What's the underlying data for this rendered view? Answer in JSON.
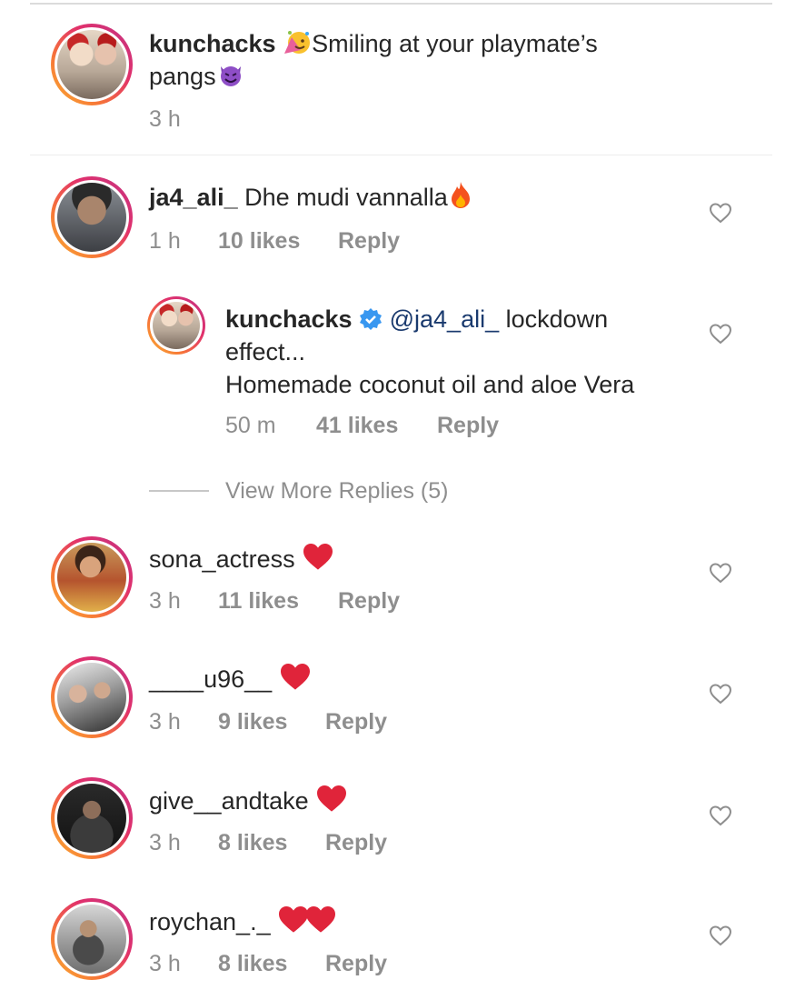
{
  "caption": {
    "username": "kunchacks",
    "text_line1": "Smiling at your playmate’s",
    "text_line2": "pangs",
    "time": "3 h"
  },
  "comments": [
    {
      "username": "ja4_ali_",
      "text": "Dhe mudi vannalla",
      "time": "1 h",
      "likes": "10 likes",
      "reply": "Reply",
      "replies": [
        {
          "username": "kunchacks",
          "mention": "@ja4_ali_",
          "text_line1": "lockdown",
          "text_line2": "effect...",
          "text_line3": "Homemade coconut oil and aloe Vera",
          "time": "50 m",
          "likes": "41 likes",
          "reply": "Reply"
        }
      ],
      "view_more": "View More Replies (5)"
    },
    {
      "username": "sona_actress",
      "time": "3 h",
      "likes": "11 likes",
      "reply": "Reply"
    },
    {
      "username": "____u96__",
      "time": "3 h",
      "likes": "9 likes",
      "reply": "Reply"
    },
    {
      "username": "give__andtake",
      "time": "3 h",
      "likes": "8 likes",
      "reply": "Reply"
    },
    {
      "username": "roychan_._",
      "time": "3 h",
      "likes": "8 likes",
      "reply": "Reply"
    }
  ],
  "colors": {
    "text": "#262626",
    "meta": "#8e8e8e",
    "mention": "#1a3a6e",
    "verified": "#3897f0",
    "heart": "#e0243a"
  }
}
